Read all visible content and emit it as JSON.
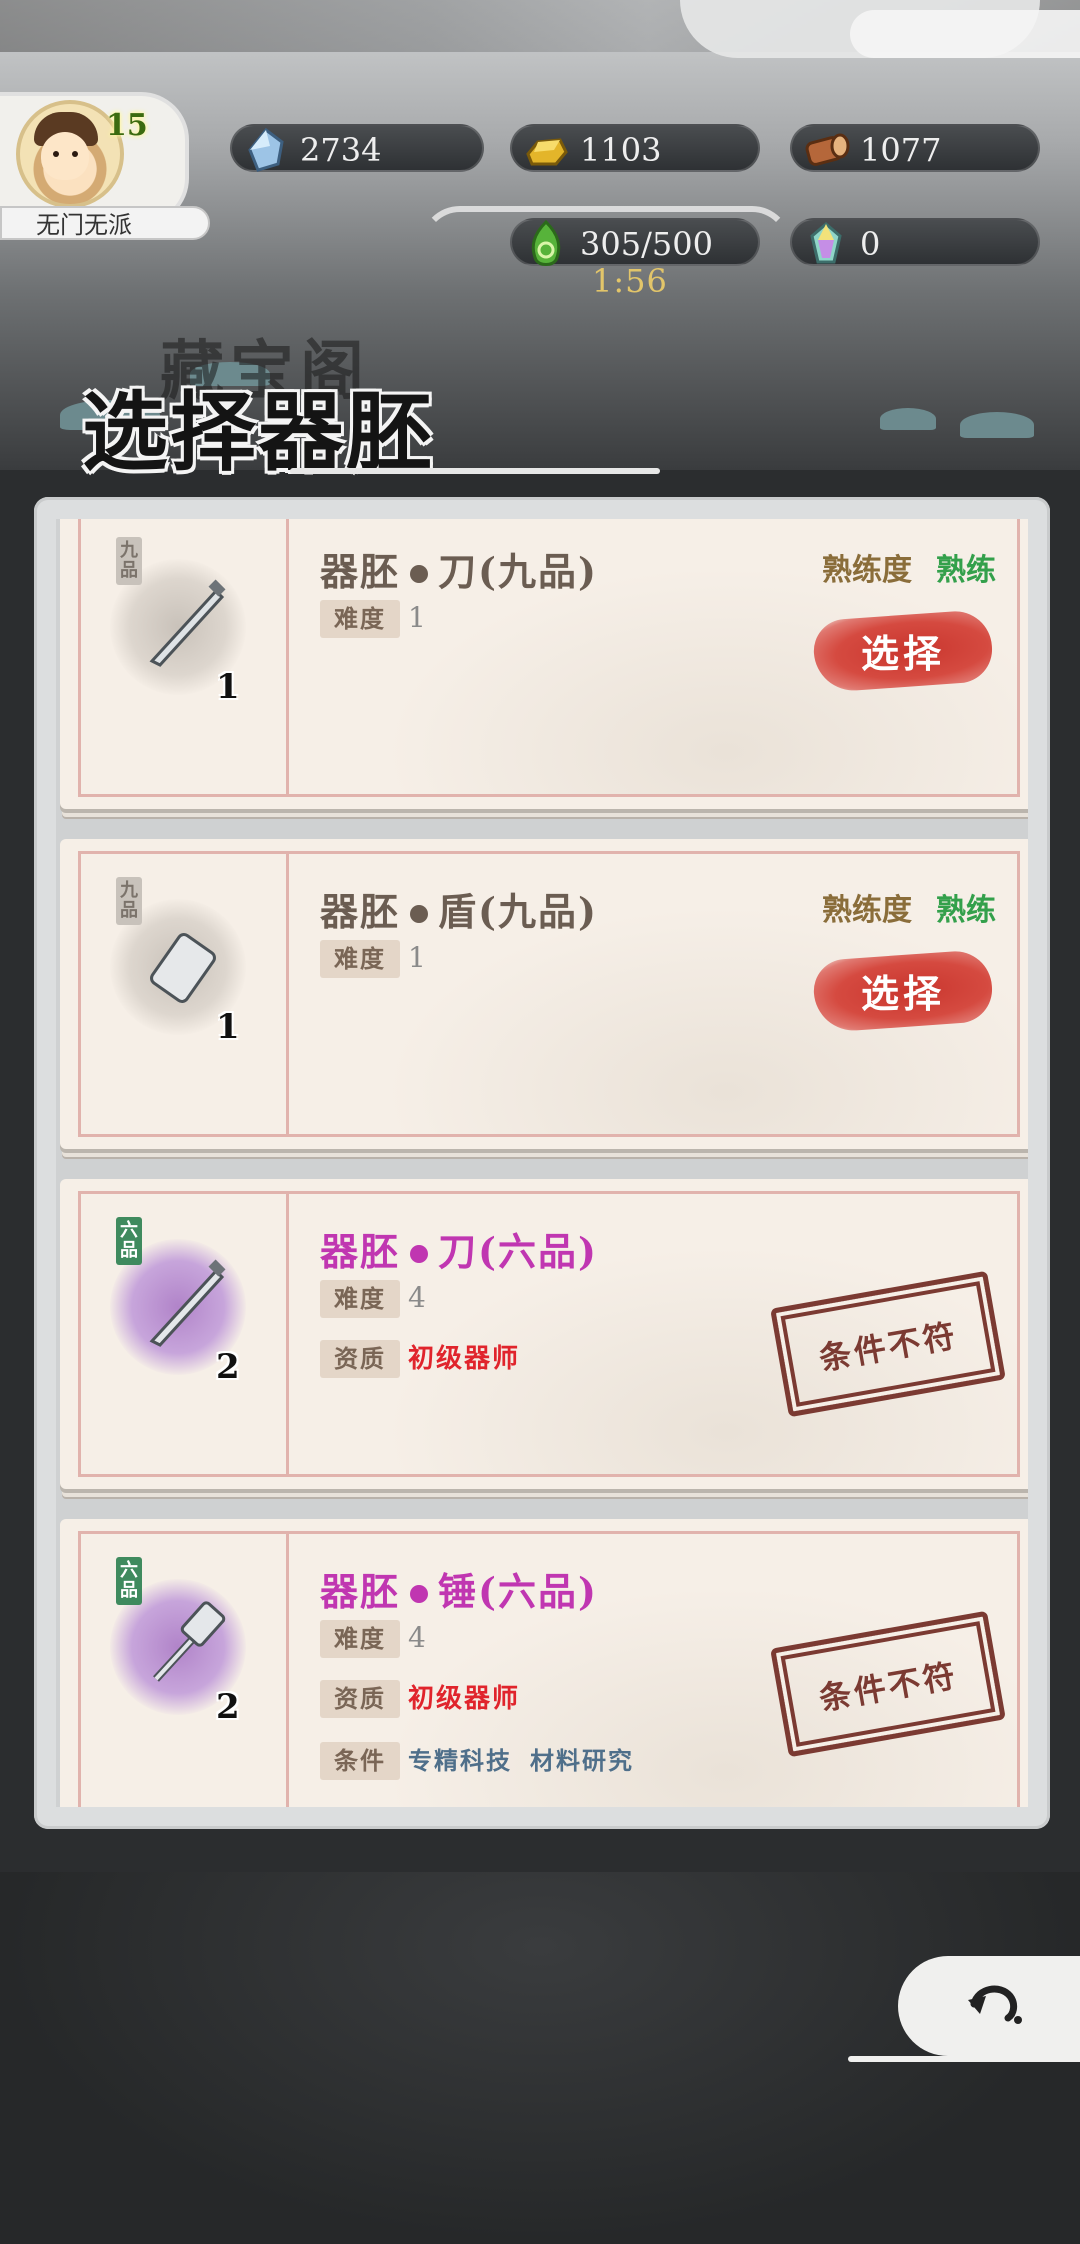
{
  "player": {
    "level": "15",
    "sect": "无门无派"
  },
  "resources": {
    "crystal": "2734",
    "gold": "1103",
    "wood": "1077",
    "energy": "305/500",
    "energy_timer": "1:56",
    "gem": "0"
  },
  "title": {
    "main": "选择器胚",
    "background": "藏宝阁"
  },
  "labels": {
    "proficiency": "熟练度",
    "difficulty": "难度",
    "qualification": "资质",
    "condition": "条件",
    "select": "选择",
    "not_met": "条件不符"
  },
  "items": [
    {
      "grade": "九品",
      "name": "器胚",
      "type": "刀(九品)",
      "count": "1",
      "proficiency": "熟练",
      "difficulty": "1"
    },
    {
      "grade": "九品",
      "name": "器胚",
      "type": "盾(九品)",
      "count": "1",
      "proficiency": "熟练",
      "difficulty": "1"
    },
    {
      "grade": "六品",
      "name": "器胚",
      "type": "刀(六品)",
      "count": "2",
      "difficulty": "4",
      "qualification": "初级器师"
    },
    {
      "grade": "六品",
      "name": "器胚",
      "type": "锤(六品)",
      "count": "2",
      "difficulty": "4",
      "qualification": "初级器师",
      "conditions": [
        "专精科技",
        "材料研究"
      ]
    }
  ],
  "colors": {
    "accent_red": "#d54a40",
    "purple_grade": "#c036b1",
    "proficiency_green": "#33a04b"
  }
}
